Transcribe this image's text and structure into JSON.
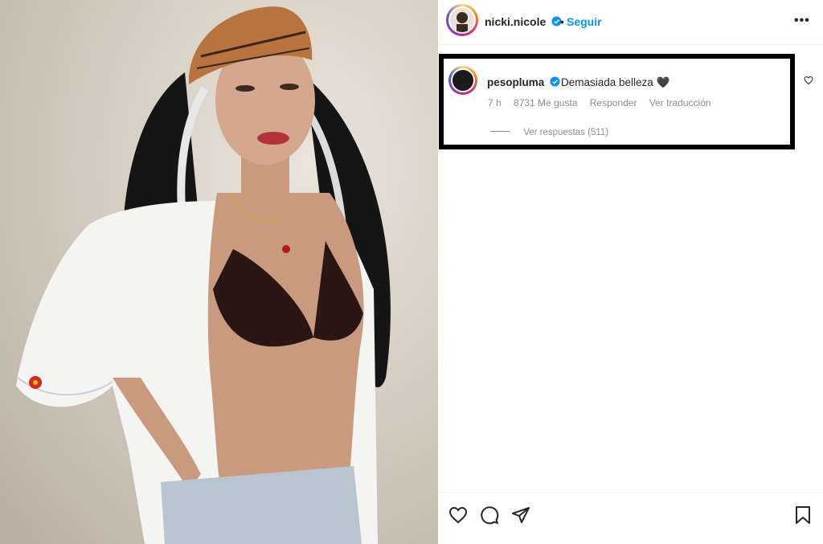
{
  "post": {
    "author": "nicki.nicole",
    "separator": "•",
    "follow_label": "Seguir",
    "more_label": "•••"
  },
  "comment": {
    "username": "pesopluma",
    "text": "Demasiada belleza 🖤",
    "time": "7 h",
    "likes": "8731 Me gusta",
    "reply_label": "Responder",
    "translate_label": "Ver traducción",
    "view_replies": "Ver respuestas (511)"
  },
  "colors": {
    "follow": "#0095f6",
    "verified": "#0095f6",
    "highlight_border": "#000000"
  },
  "icons": {
    "like": "heart-icon",
    "comment": "comment-icon",
    "share": "send-icon",
    "save": "bookmark-icon",
    "comment_like": "heart-icon"
  }
}
